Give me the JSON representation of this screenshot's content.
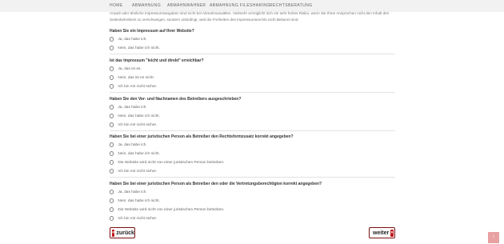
{
  "nav": [
    "HOME",
    "ABMAHNUNG",
    "ABMAHNWAHNER",
    "ABMAHNUNG FILESHARING",
    "RECHTSBERATUNG"
  ],
  "intro": "Anwalt oder ähnliche Impressumsangaben sind nicht bei Abmahnanwälten. Vielmehr ermöglicht sich ein sehr hohes Risiko, wenn Sie Ihren Ansprüchen nicht den Inhalt des Seitenbetreibers zu verschweigen, sondern unbedingt, weil die Freiheiten des Impressumsrechts nicht Bekannt sind.",
  "questions": [
    {
      "title": "Haben Sie ein Impressum auf Ihrer Website?",
      "options": [
        "Ja, das habe ich.",
        "Nein, das habe ich nicht."
      ]
    },
    {
      "title": "Ist das Impressum \"leicht und direkt\" erreichbar?",
      "options": [
        "Ja, das ist es.",
        "Nein, das ist es nicht.",
        "Ich bin mir nicht sicher."
      ]
    },
    {
      "title": "Haben Sie den Vor- und Nachnamen des Betreibers ausgeschrieben?",
      "options": [
        "Ja, das habe ich.",
        "Nein, das habe ich nicht.",
        "Ich bin mir nicht sicher."
      ]
    },
    {
      "title": "Haben Sie bei einer juristischen Person als Betreiber den Rechtsformzusatz korrekt angegeben?",
      "options": [
        "Ja, das habe ich.",
        "Nein, das habe ich nicht.",
        "Die Website wird nicht von einer juristischen Person betrieben.",
        "Ich bin mir nicht sicher."
      ]
    },
    {
      "title": "Haben Sie bei einer juristischen Person als Betreiber den oder die Vertretungsberechtigten korrekt angegeben?",
      "options": [
        "Ja, das habe ich.",
        "Nein, das habe ich nicht.",
        "Die Website wird nicht von einer juristischen Person betrieben.",
        "Ich bin mir nicht sicher."
      ]
    }
  ],
  "back_label": "zurück",
  "next_label": "weiter",
  "back_arrow": "«",
  "next_arrow": "»",
  "to_top": "↑"
}
